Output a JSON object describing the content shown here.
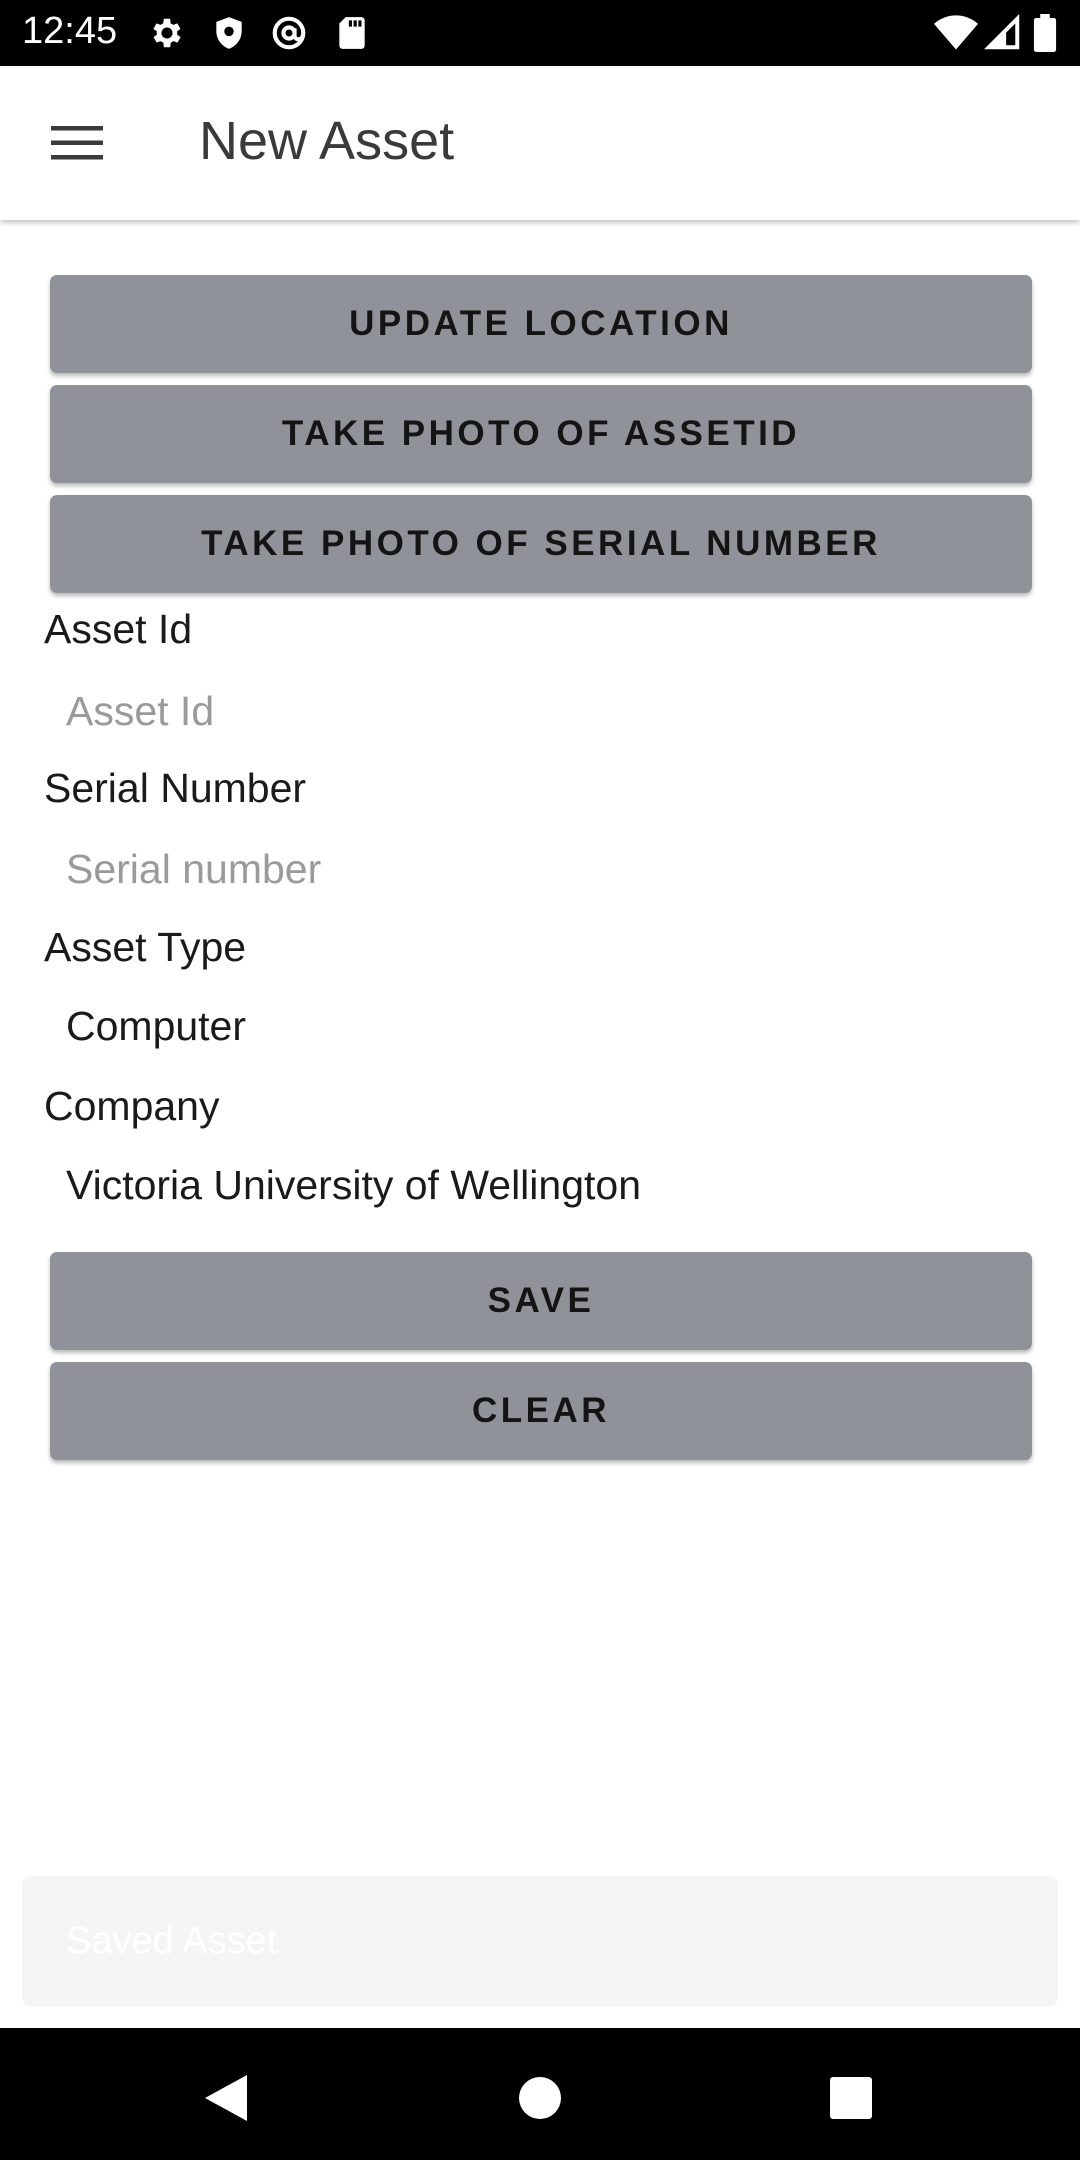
{
  "status_bar": {
    "time": "12:45",
    "left_icons": [
      "gear-icon",
      "shield-icon",
      "at-sign-icon",
      "sd-card-icon"
    ],
    "right_icons": [
      "wifi-icon",
      "cell-signal-icon",
      "battery-icon"
    ]
  },
  "app_bar": {
    "menu_icon": "hamburger-menu-icon",
    "title": "New Asset"
  },
  "actions": {
    "update_location": "UPDATE LOCATION",
    "photo_asset_id": "TAKE PHOTO OF ASSETID",
    "photo_serial": "TAKE PHOTO OF SERIAL NUMBER"
  },
  "form": {
    "asset_id": {
      "label": "Asset Id",
      "placeholder": "Asset Id",
      "value": ""
    },
    "serial_number": {
      "label": "Serial Number",
      "placeholder": "Serial number",
      "value": ""
    },
    "asset_type": {
      "label": "Asset Type",
      "value": "Computer"
    },
    "company": {
      "label": "Company",
      "value": "Victoria University of Wellington"
    }
  },
  "buttons": {
    "save": "SAVE",
    "clear": "CLEAR"
  },
  "snackbar": {
    "message": "Saved Asset"
  },
  "nav_bar": {
    "icons": [
      "back-icon",
      "home-icon",
      "recents-icon"
    ]
  },
  "colors": {
    "button_bg": "#8f9299",
    "status_bar_bg": "#000000",
    "nav_bar_bg": "#000000",
    "snackbar_bg": "#f5f5f5"
  }
}
